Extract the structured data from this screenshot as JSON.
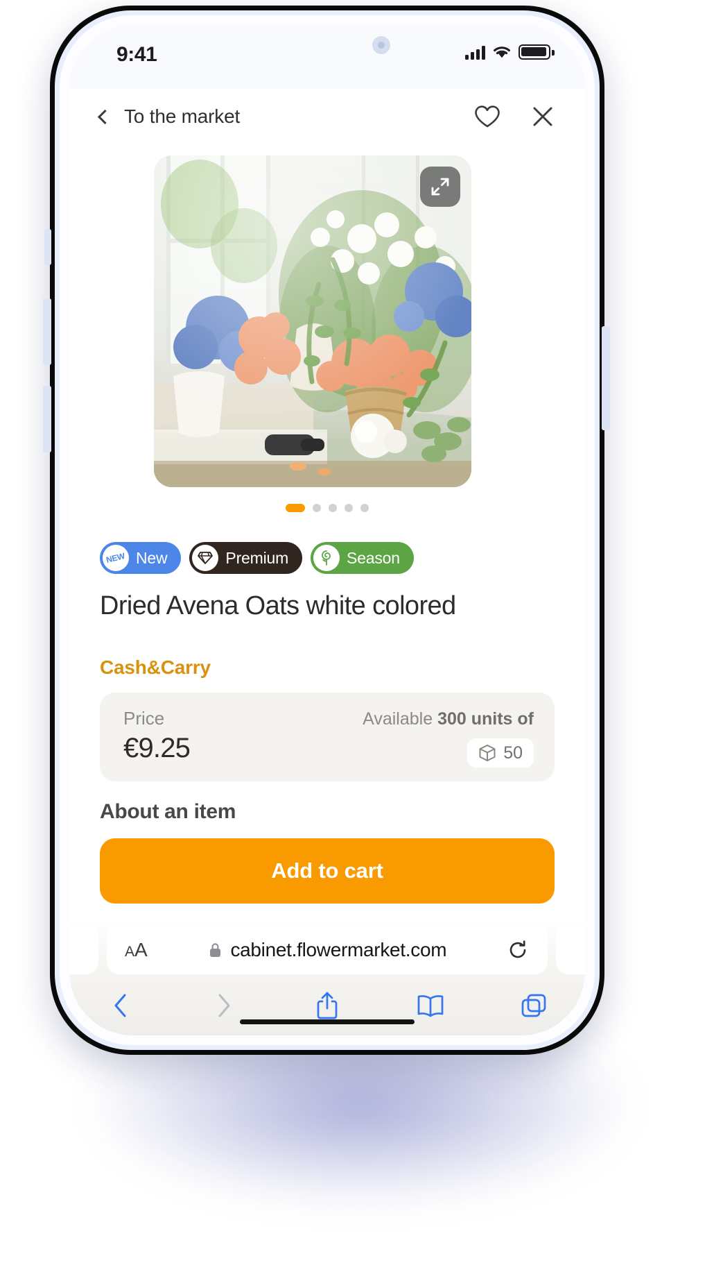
{
  "status_bar": {
    "time": "9:41",
    "signal_icon": "cellular-signal-icon",
    "wifi_icon": "wifi-icon",
    "battery_icon": "battery-full-icon"
  },
  "app_header": {
    "back_icon": "chevron-left-icon",
    "title": "To the market",
    "favorite_icon": "heart-outline-icon",
    "close_icon": "close-x-icon"
  },
  "gallery": {
    "expand_icon": "expand-fullscreen-icon",
    "alt": "white and blue flower arrangements with peach roses in a bright studio",
    "dots_total": 5,
    "active_index": 0
  },
  "badges": [
    {
      "label": "New",
      "icon": "new-star-icon",
      "glyph": "NEW",
      "color": "#4c86e8"
    },
    {
      "label": "Premium",
      "icon": "diamond-icon",
      "color": "#30251f"
    },
    {
      "label": "Season",
      "icon": "rose-flower-icon",
      "color": "#5da544"
    }
  ],
  "product": {
    "title": "Dried Avena Oats white colored",
    "seller_tag": "Cash&Carry",
    "seller_tag_color": "#d8920f"
  },
  "price_card": {
    "price_label": "Price",
    "price_value": "€9.25",
    "available_prefix": "Available ",
    "available_strong": "300 units of",
    "pack_icon": "package-box-icon",
    "pack_count": "50"
  },
  "sections": {
    "about_title": "About an item"
  },
  "cta": {
    "label": "Add to cart",
    "color": "#f99a00"
  },
  "browser": {
    "text_size_small": "A",
    "text_size_large": "A",
    "lock_icon": "lock-icon",
    "url": "cabinet.flowermarket.com",
    "reload_icon": "reload-icon",
    "toolbar": [
      {
        "name": "back",
        "icon": "chevron-left-icon",
        "enabled": true
      },
      {
        "name": "forward",
        "icon": "chevron-right-icon",
        "enabled": false
      },
      {
        "name": "share",
        "icon": "share-up-icon",
        "enabled": true
      },
      {
        "name": "bookmarks",
        "icon": "book-open-icon",
        "enabled": true
      },
      {
        "name": "tabs",
        "icon": "tabs-squares-icon",
        "enabled": true
      }
    ]
  }
}
